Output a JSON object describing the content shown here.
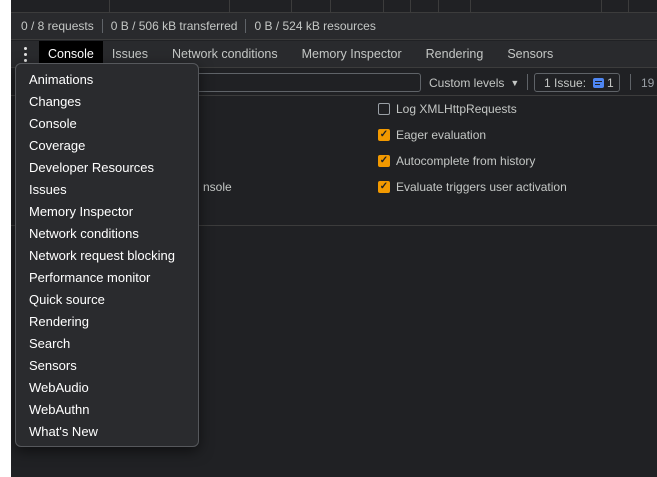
{
  "network_summary": {
    "requests": "0 / 8 requests",
    "transferred": "0 B / 506 kB transferred",
    "resources": "0 B / 524 kB resources"
  },
  "tabs": [
    {
      "label": "Console",
      "active": true
    },
    {
      "label": "Issues",
      "active": false
    },
    {
      "label": "Network conditions",
      "active": false
    },
    {
      "label": "Memory Inspector",
      "active": false
    },
    {
      "label": "Rendering",
      "active": false
    },
    {
      "label": "Sensors",
      "active": false
    }
  ],
  "toolbar": {
    "levels_label": "Custom levels",
    "issues_label": "1 Issue:",
    "issues_count": "1",
    "hidden_count": "19"
  },
  "settings": [
    {
      "label": "Log XMLHttpRequests",
      "checked": false
    },
    {
      "label": "Eager evaluation",
      "checked": true
    },
    {
      "label": "Autocomplete from history",
      "checked": true
    },
    {
      "label": "Evaluate triggers user activation",
      "checked": true
    }
  ],
  "left_partial_text": "nsole",
  "menu": {
    "items": [
      "Animations",
      "Changes",
      "Console",
      "Coverage",
      "Developer Resources",
      "Issues",
      "Memory Inspector",
      "Network conditions",
      "Network request blocking",
      "Performance monitor",
      "Quick source",
      "Rendering",
      "Search",
      "Sensors",
      "WebAudio",
      "WebAuthn",
      "What's New"
    ]
  },
  "colors": {
    "panel_bg": "#202124",
    "toolbar_bg": "#292a2d",
    "checkbox_on": "#f29900",
    "issue_icon": "#4e86f3",
    "menu_bg": "#2a2b2e"
  }
}
